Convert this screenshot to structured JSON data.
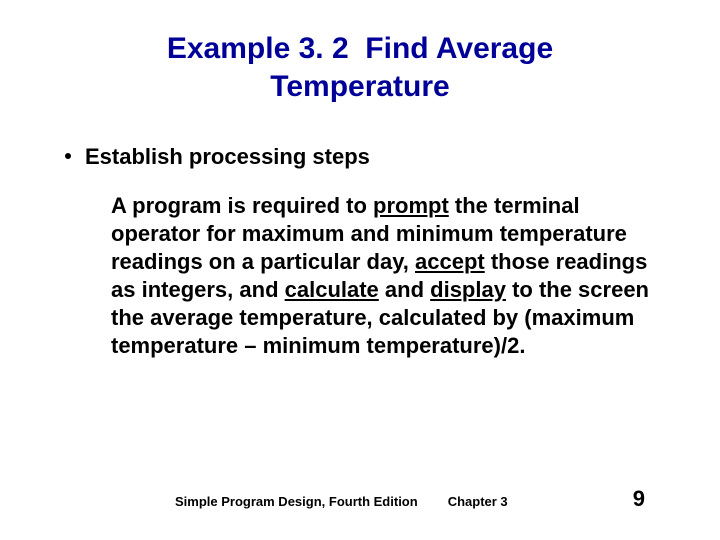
{
  "title_line1": "Example 3. 2  Find Average",
  "title_line2": "Temperature",
  "bullet": "Establish processing steps",
  "body": {
    "t1": "A program is required to ",
    "u1": "prompt",
    "t2": " the terminal operator for maximum and minimum temperature readings on a particular day, ",
    "u2": "accept",
    "t3": " those readings as integers, and ",
    "u3": "calculate",
    "t4": " and ",
    "u4": "display",
    "t5": " to the screen the average temperature, calculated by (maximum temperature – minimum temperature)/2."
  },
  "footer": {
    "book": "Simple Program Design, Fourth Edition",
    "chapter": "Chapter 3",
    "page": "9"
  }
}
